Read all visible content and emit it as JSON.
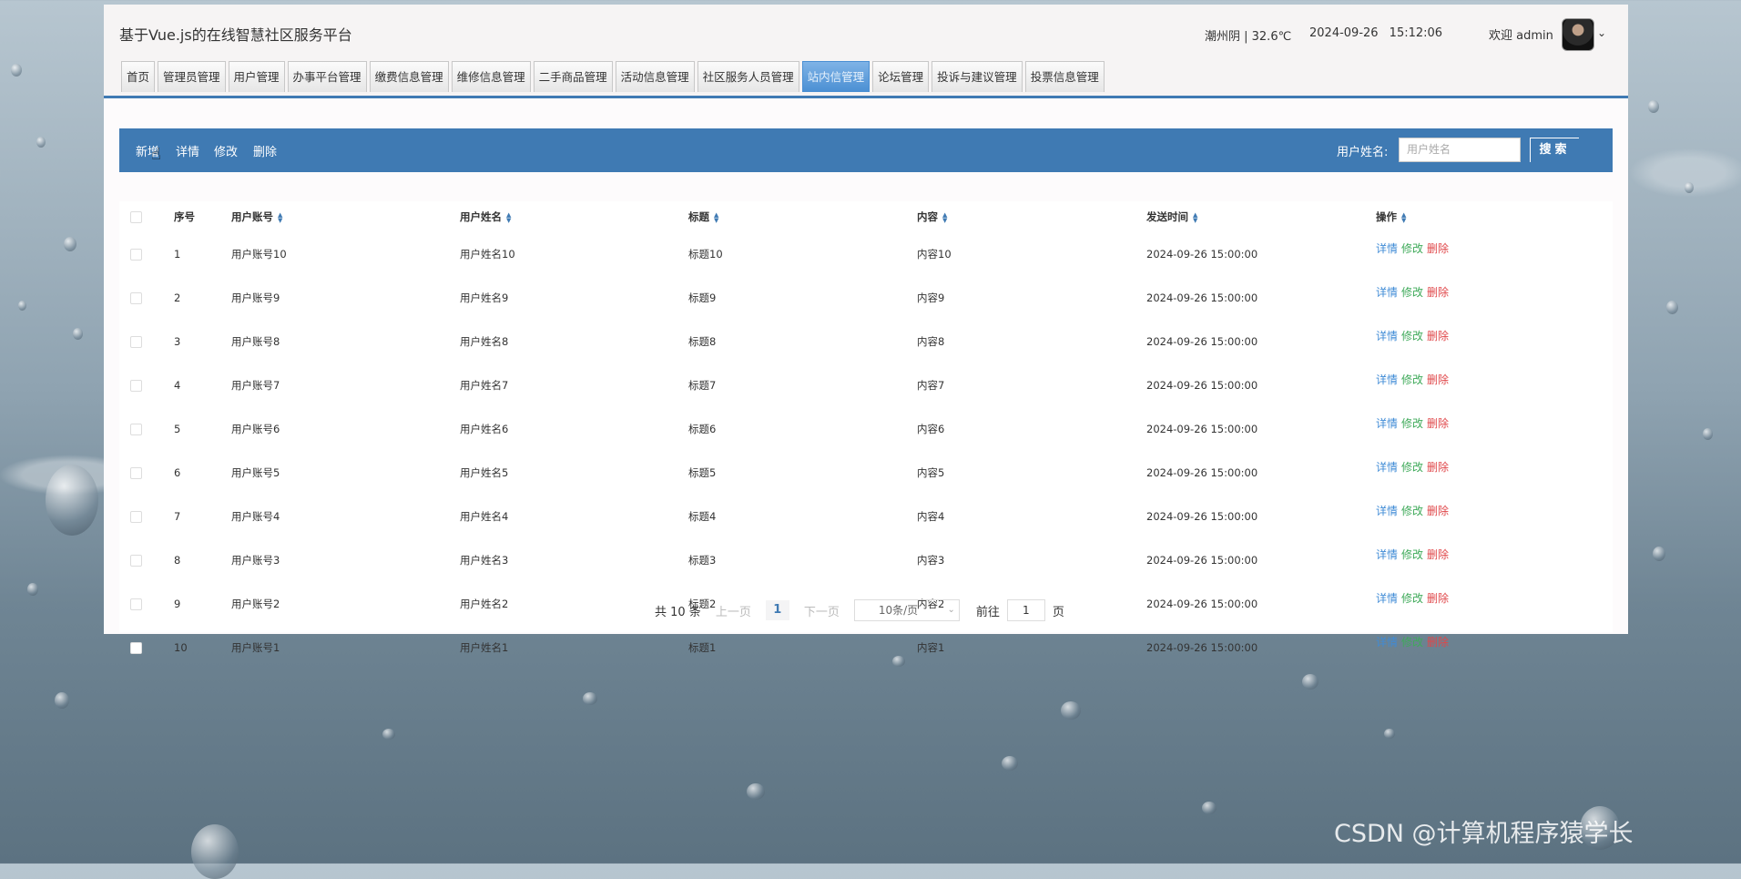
{
  "header": {
    "site_title": "基于Vue.js的在线智慧社区服务平台",
    "weather": "潮州阴 | 32.6℃",
    "datetime": "2024-09-26 15:12:06",
    "welcome": "欢迎 admin",
    "caret": "⌄"
  },
  "nav": {
    "tabs": [
      {
        "label": "首页"
      },
      {
        "label": "管理员管理"
      },
      {
        "label": "用户管理"
      },
      {
        "label": "办事平台管理"
      },
      {
        "label": "缴费信息管理"
      },
      {
        "label": "维修信息管理"
      },
      {
        "label": "二手商品管理"
      },
      {
        "label": "活动信息管理"
      },
      {
        "label": "社区服务人员管理"
      },
      {
        "label": "站内信管理",
        "active": true
      },
      {
        "label": "论坛管理"
      },
      {
        "label": "投诉与建议管理"
      },
      {
        "label": "投票信息管理"
      }
    ]
  },
  "toolbar": {
    "add": "新增",
    "detail": "详情",
    "edit": "修改",
    "delete": "删除",
    "search_label": "用户姓名:",
    "search_placeholder": "用户姓名",
    "search_button": "搜索"
  },
  "table": {
    "columns": [
      "序号",
      "用户账号",
      "用户姓名",
      "标题",
      "内容",
      "发送时间",
      "操作"
    ],
    "rows": [
      {
        "no": "1",
        "account": "用户账号10",
        "name": "用户姓名10",
        "title": "标题10",
        "content": "内容10",
        "time": "2024-09-26 15:00:00"
      },
      {
        "no": "2",
        "account": "用户账号9",
        "name": "用户姓名9",
        "title": "标题9",
        "content": "内容9",
        "time": "2024-09-26 15:00:00"
      },
      {
        "no": "3",
        "account": "用户账号8",
        "name": "用户姓名8",
        "title": "标题8",
        "content": "内容8",
        "time": "2024-09-26 15:00:00"
      },
      {
        "no": "4",
        "account": "用户账号7",
        "name": "用户姓名7",
        "title": "标题7",
        "content": "内容7",
        "time": "2024-09-26 15:00:00"
      },
      {
        "no": "5",
        "account": "用户账号6",
        "name": "用户姓名6",
        "title": "标题6",
        "content": "内容6",
        "time": "2024-09-26 15:00:00"
      },
      {
        "no": "6",
        "account": "用户账号5",
        "name": "用户姓名5",
        "title": "标题5",
        "content": "内容5",
        "time": "2024-09-26 15:00:00"
      },
      {
        "no": "7",
        "account": "用户账号4",
        "name": "用户姓名4",
        "title": "标题4",
        "content": "内容4",
        "time": "2024-09-26 15:00:00"
      },
      {
        "no": "8",
        "account": "用户账号3",
        "name": "用户姓名3",
        "title": "标题3",
        "content": "内容3",
        "time": "2024-09-26 15:00:00"
      },
      {
        "no": "9",
        "account": "用户账号2",
        "name": "用户姓名2",
        "title": "标题2",
        "content": "内容2",
        "time": "2024-09-26 15:00:00"
      },
      {
        "no": "10",
        "account": "用户账号1",
        "name": "用户姓名1",
        "title": "标题1",
        "content": "内容1",
        "time": "2024-09-26 15:00:00"
      }
    ],
    "ops": {
      "detail": "详情",
      "edit": "修改",
      "delete": "删除"
    }
  },
  "pager": {
    "total": "共 10 条",
    "prev": "上一页",
    "page": "1",
    "next": "下一页",
    "page_size": "10条/页",
    "goto_label": "前往",
    "goto_value": "1",
    "goto_suffix": "页"
  },
  "watermark": "CSDN @计算机程序猿学长",
  "colors": {
    "primary": "#3f7ab3",
    "detail": "#3f8bd6",
    "edit": "#3faa5a",
    "delete": "#e0474a"
  }
}
